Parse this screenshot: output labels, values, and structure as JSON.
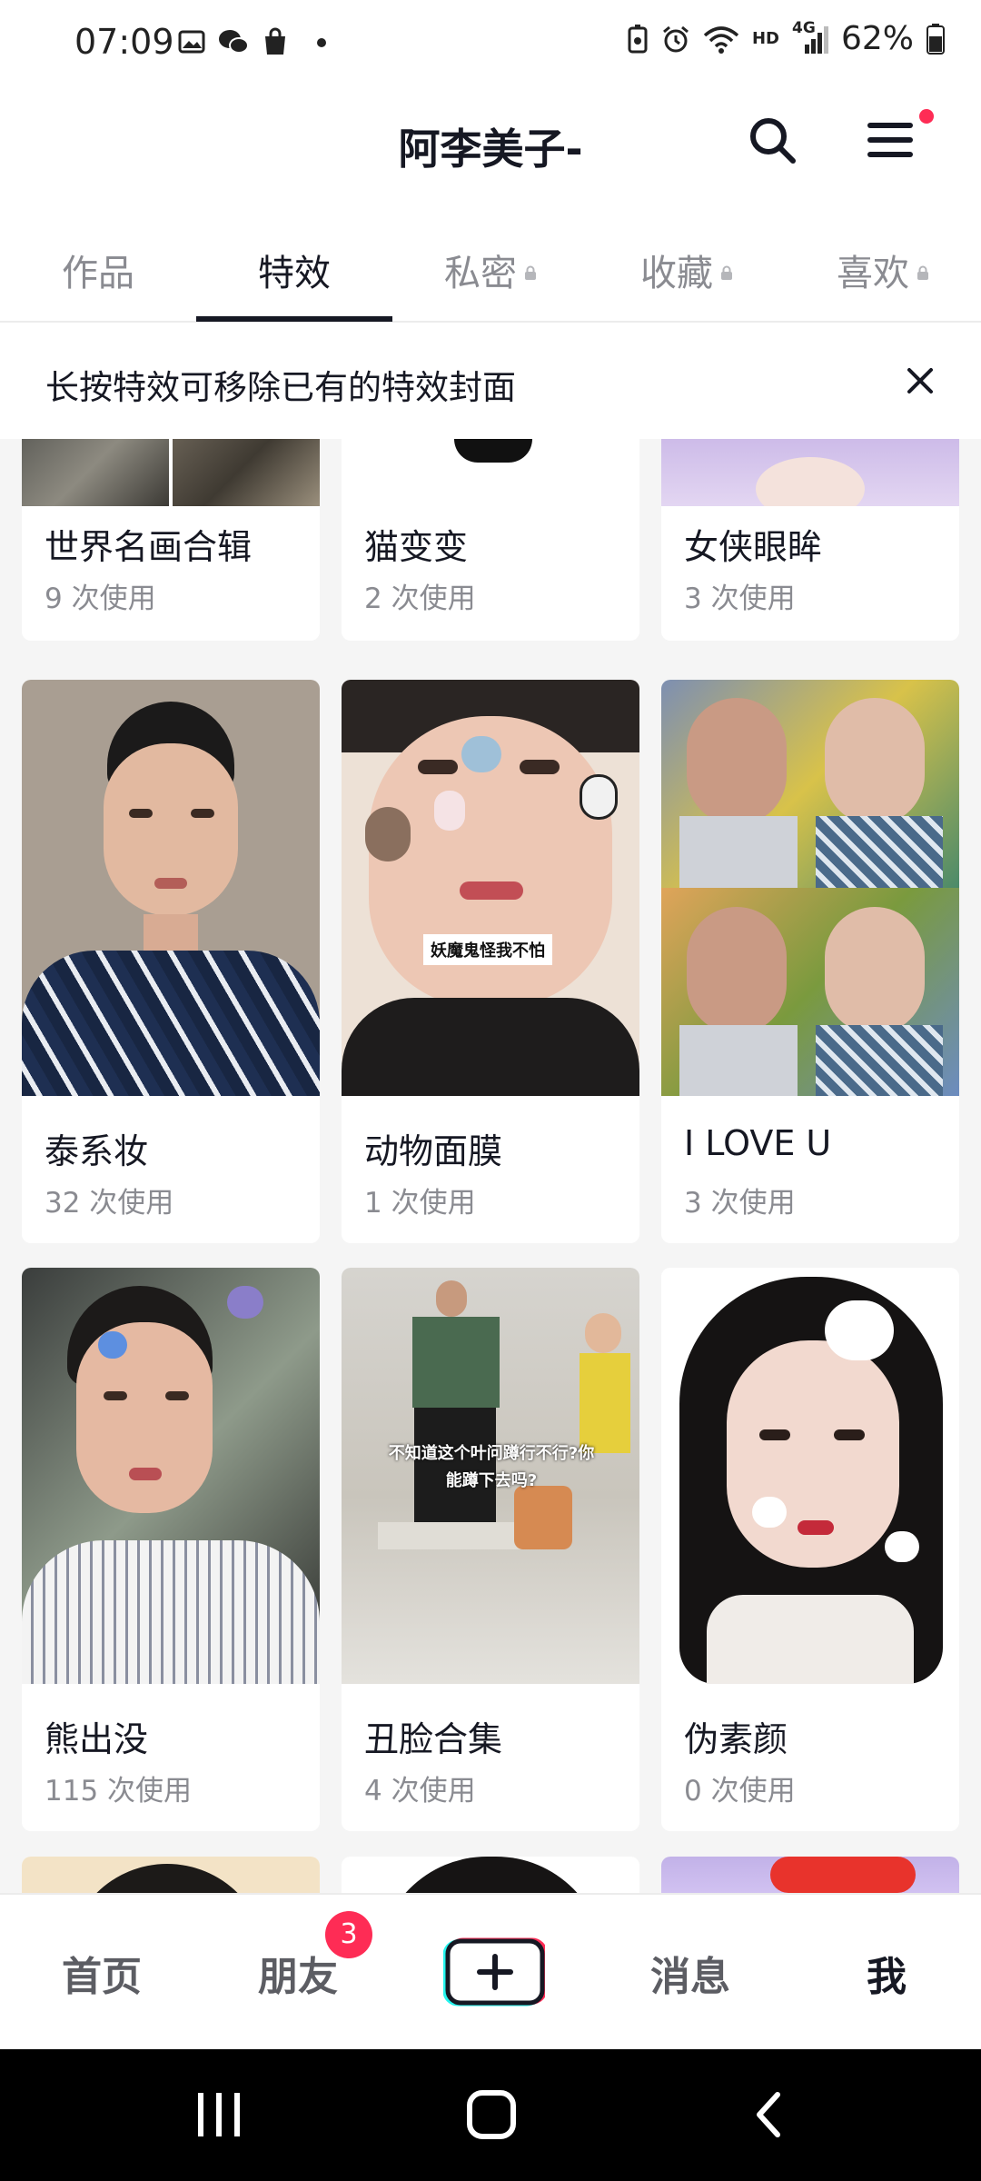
{
  "status_bar": {
    "time": "07:09",
    "signal_text": "4G",
    "hd_text": "HD",
    "battery_pct": "62%",
    "icons": [
      "gallery-icon",
      "wechat-icon",
      "shopping-bag-icon",
      "dot-icon",
      "battery-saver-icon",
      "alarm-icon",
      "wifi-icon",
      "signal-icon",
      "battery-icon"
    ]
  },
  "header": {
    "title": "阿李美子-",
    "accent_color": "#fe2c55"
  },
  "tabs": [
    {
      "label": "作品",
      "locked": false
    },
    {
      "label": "特效",
      "locked": false,
      "active": true
    },
    {
      "label": "私密",
      "locked": true
    },
    {
      "label": "收藏",
      "locked": true
    },
    {
      "label": "喜欢",
      "locked": true
    }
  ],
  "tip": {
    "text": "长按特效可移除已有的特效封面"
  },
  "effects": [
    {
      "name": "世界名画合辑",
      "uses": "9 次使用"
    },
    {
      "name": "猫变变",
      "uses": "2 次使用"
    },
    {
      "name": "女侠眼眸",
      "uses": "3 次使用"
    },
    {
      "name": "泰系妆",
      "uses": "32 次使用"
    },
    {
      "name": "动物面膜",
      "uses": "1 次使用",
      "overlay_caption": "妖魔鬼怪我不怕"
    },
    {
      "name": "I LOVE U",
      "uses": "3 次使用"
    },
    {
      "name": "熊出没",
      "uses": "115 次使用"
    },
    {
      "name": "丑脸合集",
      "uses": "4 次使用",
      "overlay_caption": "不知道这个叶问蹲行不行?你能蹲下去吗?"
    },
    {
      "name": "伪素颜",
      "uses": "0 次使用"
    }
  ],
  "bottom_nav": [
    {
      "label": "首页"
    },
    {
      "label": "朋友",
      "badge": "3"
    },
    {
      "label": "",
      "icon": "plus-icon"
    },
    {
      "label": "消息"
    },
    {
      "label": "我",
      "active": true
    }
  ]
}
